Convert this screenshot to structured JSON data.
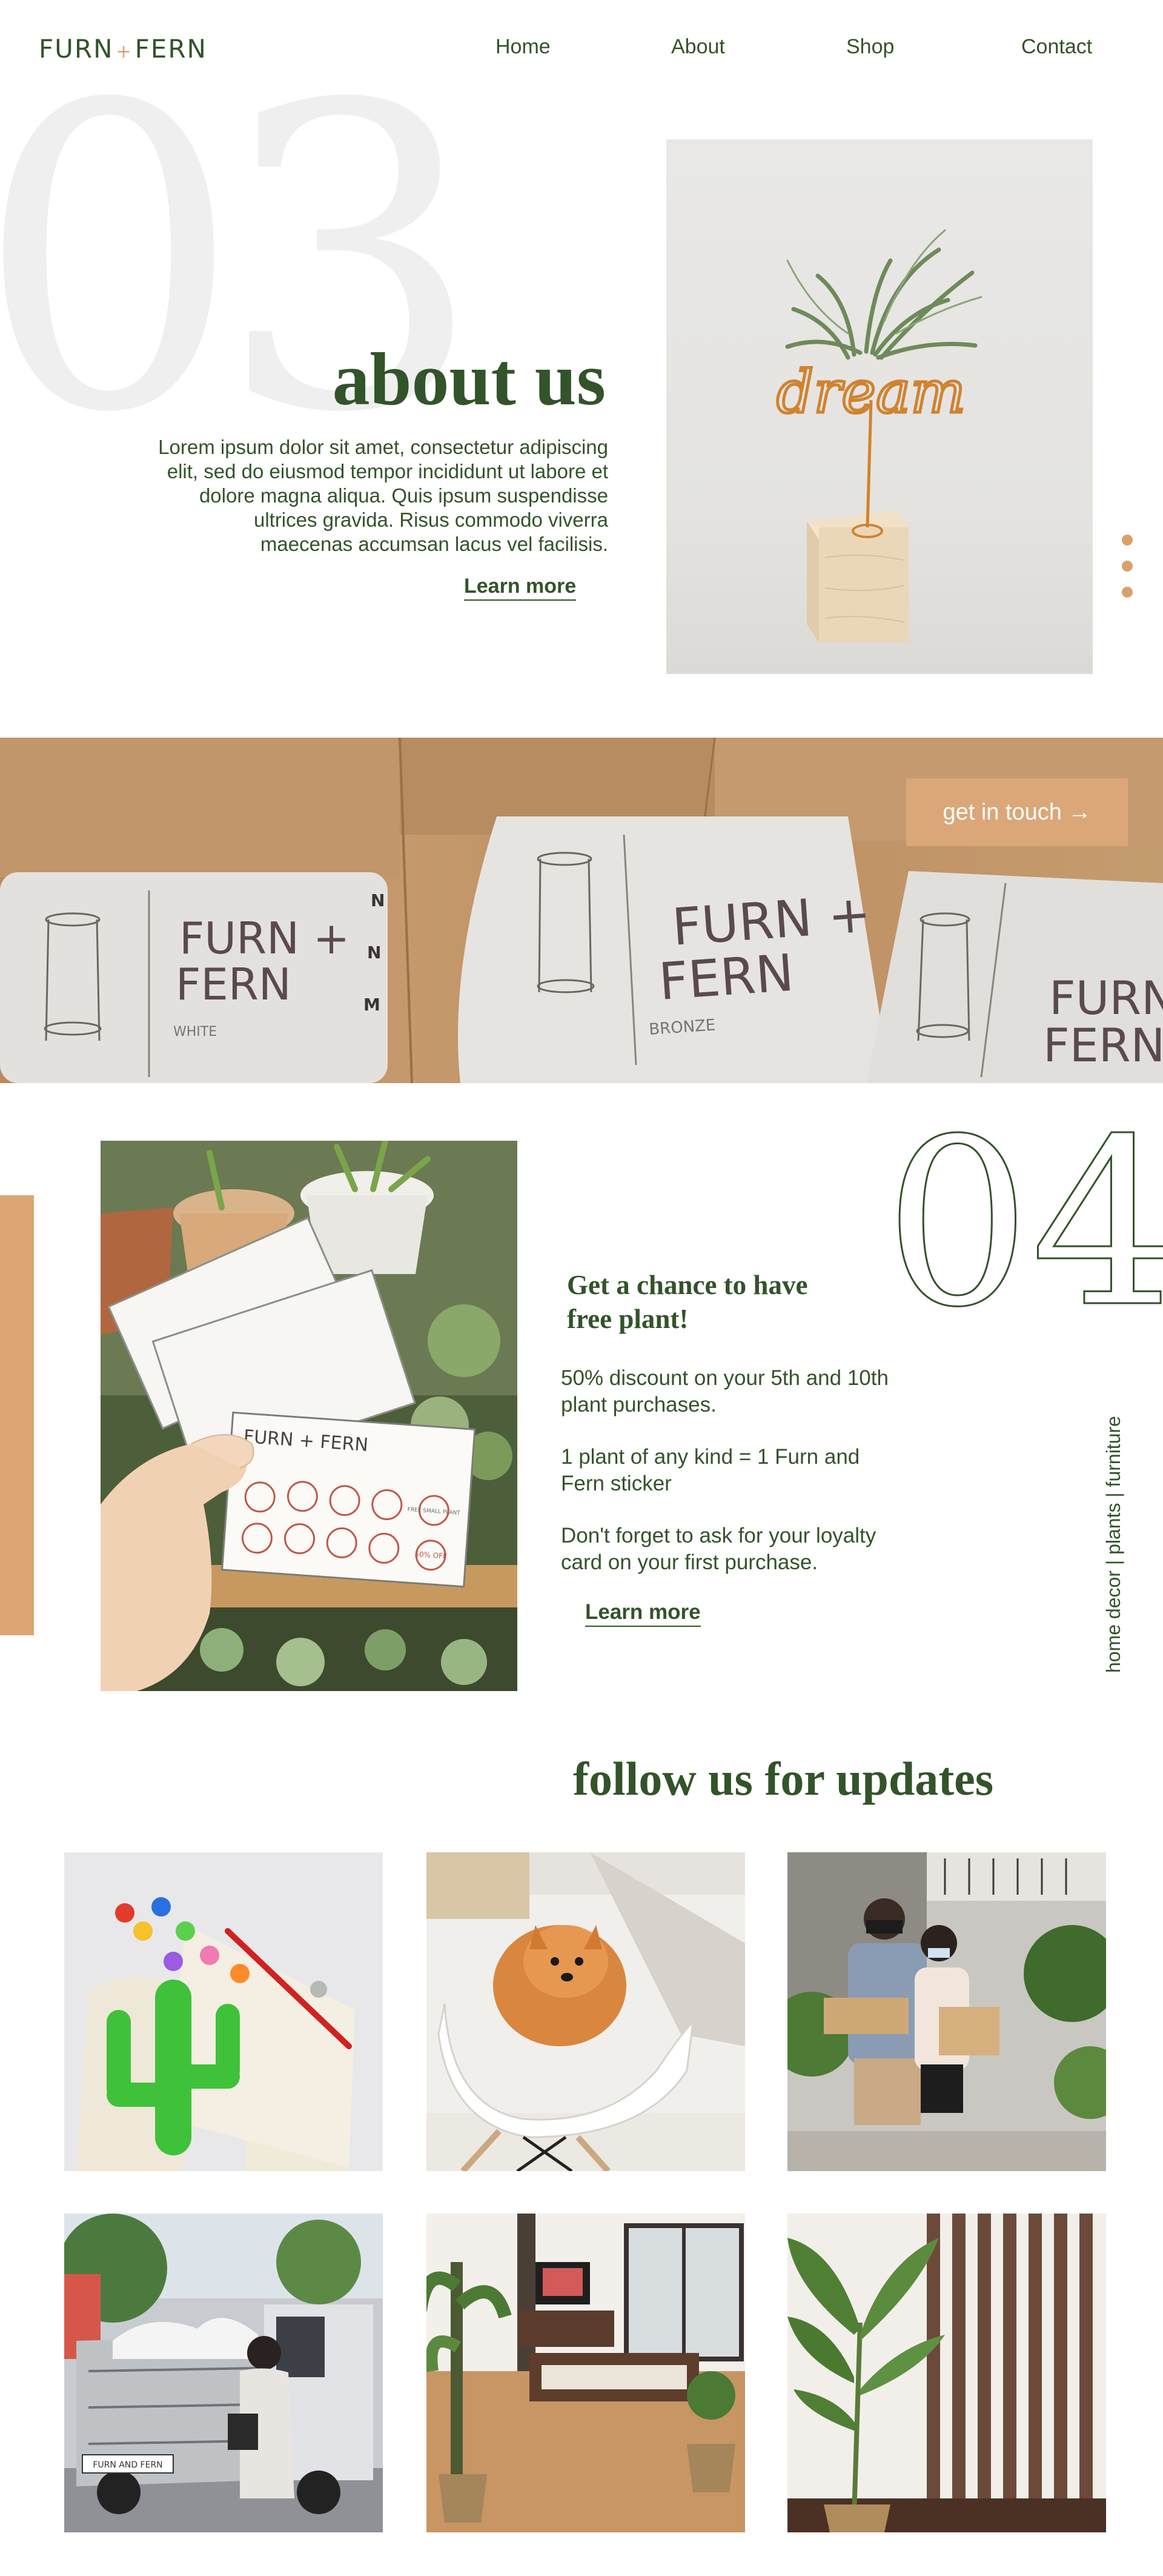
{
  "header": {
    "logo_left": "FURN",
    "logo_plus": "+",
    "logo_right": "FERN",
    "nav": [
      "Home",
      "About",
      "Shop",
      "Contact"
    ]
  },
  "about": {
    "number": "03",
    "title": "about us",
    "text": "Lorem ipsum dolor sit amet, consectetur adipiscing elit, sed do eiusmod tempor incididunt ut labore et dolore magna aliqua. Quis ipsum suspendisse ultrices gravida. Risus commodo viverra maecenas accumsan lacus vel facilisis.",
    "learn_more": "Learn more",
    "photo_word": "dream"
  },
  "banner": {
    "cta": "get in touch →",
    "box1_brand_top": "FURN +",
    "box1_brand_bottom": "FERN",
    "box1_color": "WHITE",
    "box1_sizes": [
      "N",
      "N",
      "M"
    ],
    "box2_brand_top": "FURN +",
    "box2_brand_bottom": "FERN",
    "box2_color": "BRONZE",
    "box3_brand_top": "FURN",
    "box3_brand_bottom": "FERN"
  },
  "loyalty": {
    "number": "04",
    "title": "Get a chance to have free plant!",
    "line1": "50% discount on your 5th and 10th plant purchases.",
    "line2": "1 plant of any kind = 1 Furn and Fern sticker",
    "line3": "Don't forget to ask for your loyalty card on your first purchase.",
    "learn_more": "Learn more",
    "tagline": "home decor | plants | furniture",
    "card_brand": "FURN + FERN",
    "card_stamp_free": "FREE SMALL PLANT",
    "card_stamp_off": "50% OFF"
  },
  "follow": {
    "title": "follow us for updates",
    "posts": [
      {
        "subject": "cactus-painting"
      },
      {
        "subject": "dog-on-chair"
      },
      {
        "subject": "customers-with-boxes"
      },
      {
        "subject": "delivery-truck"
      },
      {
        "subject": "living-room-plants"
      },
      {
        "subject": "plant-and-slats"
      }
    ],
    "truck_sign": "FURN AND FERN"
  },
  "colors": {
    "brand_green": "#33532a",
    "accent_tan": "#d9a06c",
    "watermark_gray": "#efefef"
  }
}
